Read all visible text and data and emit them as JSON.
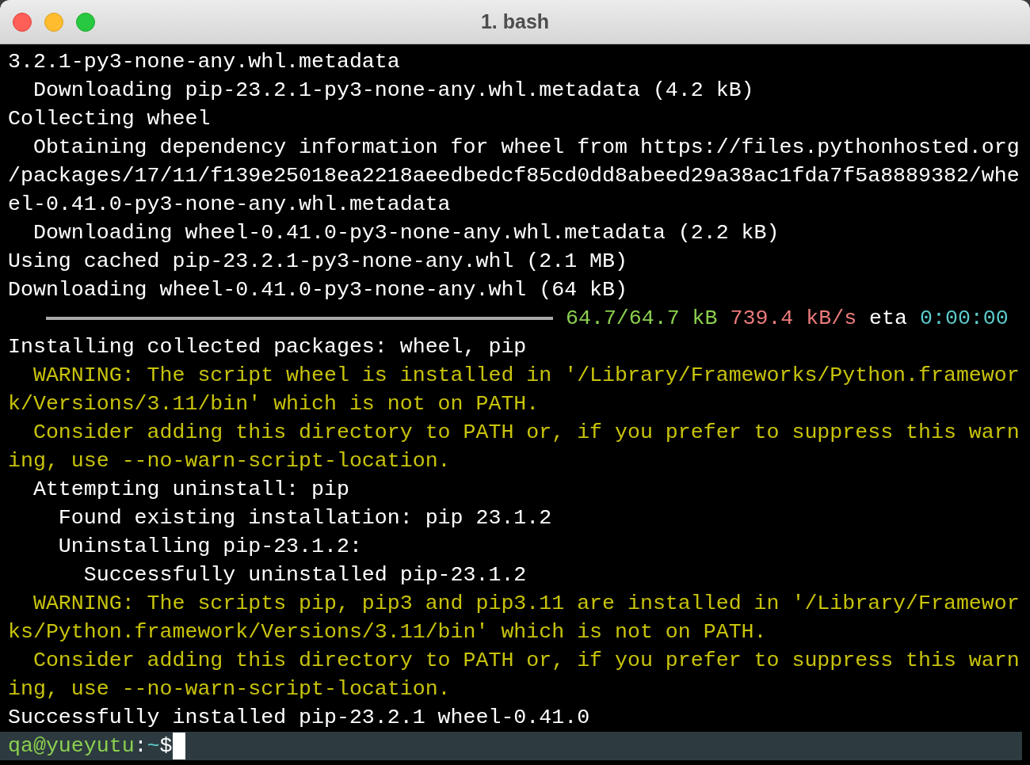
{
  "window": {
    "title": "1. bash",
    "buttons": [
      {
        "kind": "close"
      },
      {
        "kind": "minimize"
      },
      {
        "kind": "zoom"
      }
    ]
  },
  "terminal": {
    "lines": [
      {
        "kind": "output",
        "text": "3.2.1-py3-none-any.whl.metadata"
      },
      {
        "kind": "output",
        "text": "  Downloading pip-23.2.1-py3-none-any.whl.metadata (4.2 kB)"
      },
      {
        "kind": "output",
        "text": "Collecting wheel"
      },
      {
        "kind": "output",
        "text": "  Obtaining dependency information for wheel from https://files.pythonhosted.org"
      },
      {
        "kind": "output",
        "text": "/packages/17/11/f139e25018ea2218aeedbedcf85cd0dd8abeed29a38ac1fda7f5a8889382/whe"
      },
      {
        "kind": "output",
        "text": "el-0.41.0-py3-none-any.whl.metadata"
      },
      {
        "kind": "output",
        "text": "  Downloading wheel-0.41.0-py3-none-any.whl.metadata (2.2 kB)"
      },
      {
        "kind": "output",
        "text": "Using cached pip-23.2.1-py3-none-any.whl (2.1 MB)"
      },
      {
        "kind": "output",
        "text": "Downloading wheel-0.41.0-py3-none-any.whl (64 kB)"
      },
      {
        "kind": "progress",
        "level": 1,
        "size": "64.7/64.7 kB",
        "rate": "739.4 kB/s",
        "eta_label": "eta",
        "eta": "0:00:00"
      },
      {
        "kind": "output",
        "text": "Installing collected packages: wheel, pip"
      },
      {
        "kind": "warning",
        "text": "  WARNING: The script wheel is installed in '/Library/Frameworks/Python.framewor"
      },
      {
        "kind": "warning",
        "text": "k/Versions/3.11/bin' which is not on PATH."
      },
      {
        "kind": "warning",
        "text": "  Consider adding this directory to PATH or, if you prefer to suppress this warn"
      },
      {
        "kind": "warning",
        "text": "ing, use --no-warn-script-location."
      },
      {
        "kind": "output",
        "text": "  Attempting uninstall: pip"
      },
      {
        "kind": "output",
        "text": "    Found existing installation: pip 23.1.2"
      },
      {
        "kind": "output",
        "text": "    Uninstalling pip-23.1.2:"
      },
      {
        "kind": "output",
        "text": "      Successfully uninstalled pip-23.1.2"
      },
      {
        "kind": "warning",
        "text": "  WARNING: The scripts pip, pip3 and pip3.11 are installed in '/Library/Framewor"
      },
      {
        "kind": "warning",
        "text": "ks/Python.framework/Versions/3.11/bin' which is not on PATH."
      },
      {
        "kind": "warning",
        "text": "  Consider adding this directory to PATH or, if you prefer to suppress this warn"
      },
      {
        "kind": "warning",
        "text": "ing, use --no-warn-script-location."
      },
      {
        "kind": "output",
        "text": "Successfully installed pip-23.2.1 wheel-0.41.0"
      }
    ],
    "prompt": {
      "user_host": "qa@yueyutu",
      "separator": ":",
      "path": "~",
      "symbol": "$"
    }
  }
}
